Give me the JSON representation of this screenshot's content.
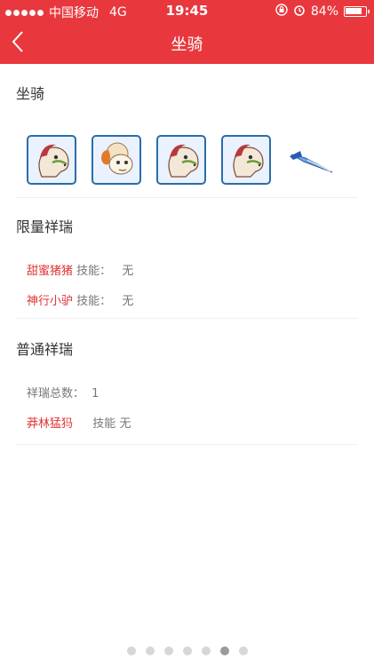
{
  "status": {
    "carrier": "中国移动",
    "network": "4G",
    "time": "19:45",
    "battery": "84%",
    "battery_level": 0.84
  },
  "header": {
    "title": "坐骑"
  },
  "mount_section": {
    "title": "坐骑",
    "items": [
      {
        "icon": "pony-mount-icon"
      },
      {
        "icon": "sheep-mount-icon"
      },
      {
        "icon": "pony-mount-icon"
      },
      {
        "icon": "pony-mount-icon"
      },
      {
        "icon": "flying-sword-icon"
      }
    ]
  },
  "limited": {
    "title": "限量祥瑞",
    "rows": [
      {
        "name": "甜蜜猪猪",
        "skill_label": "技能：",
        "skill_value": "无"
      },
      {
        "name": "神行小驴",
        "skill_label": "技能：",
        "skill_value": "无"
      }
    ]
  },
  "normal": {
    "title": "普通祥瑞",
    "count_label": "祥瑞总数：",
    "count_value": "1",
    "rows": [
      {
        "name": "莽林猛犸",
        "skill_label": "技能",
        "skill_value": "无"
      }
    ]
  },
  "pager": {
    "count": 7,
    "active_index": 5
  },
  "colors": {
    "header": "#e8383d",
    "accent_red": "#e03434"
  }
}
